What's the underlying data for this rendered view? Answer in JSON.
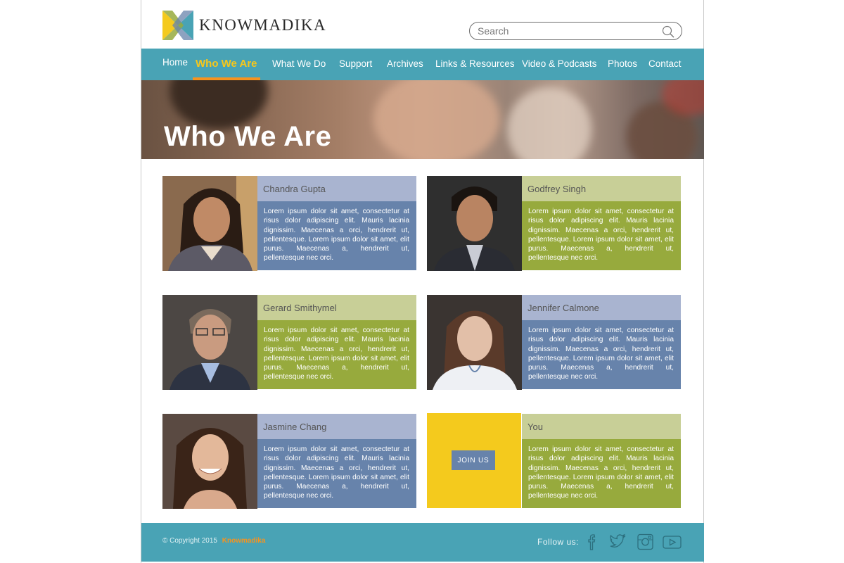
{
  "brand": {
    "name": "KNOWMADIKA"
  },
  "search": {
    "placeholder": "Search"
  },
  "nav": {
    "items": [
      {
        "label": "Home"
      },
      {
        "label": "Who We Are"
      },
      {
        "label": "What We Do"
      },
      {
        "label": "Support"
      },
      {
        "label": "Archives"
      },
      {
        "label": "Links & Resources"
      },
      {
        "label": "Video & Podcasts"
      },
      {
        "label": "Photos"
      },
      {
        "label": "Contact"
      }
    ],
    "active": "Who We Are"
  },
  "hero": {
    "title": "Who We Are"
  },
  "members": [
    {
      "name": "Chandra Gupta",
      "bio": "Lorem ipsum dolor sit amet, consectetur at risus dolor adipiscing elit. Mauris lacinia dignissim. Maecenas a orci, hendrerit ut, pellentesque. Lorem ipsum dolor sit amet, elit purus. Maecenas a, hendrerit ut, pellentesque nec orci."
    },
    {
      "name": "Godfrey Singh",
      "bio": "Lorem ipsum dolor sit amet, consectetur at risus dolor adipiscing elit. Mauris lacinia dignissim. Maecenas a orci, hendrerit ut, pellentesque. Lorem ipsum dolor sit amet, elit purus. Maecenas a, hendrerit ut, pellentesque nec orci."
    },
    {
      "name": "Gerard Smithymel",
      "bio": "Lorem ipsum dolor sit amet, consectetur at risus dolor adipiscing elit. Mauris lacinia dignissim. Maecenas a orci, hendrerit ut, pellentesque. Lorem ipsum dolor sit amet, elit purus. Maecenas a, hendrerit ut, pellentesque nec orci."
    },
    {
      "name": "Jennifer Calmone",
      "bio": "Lorem ipsum dolor sit amet, consectetur at risus dolor adipiscing elit. Mauris lacinia dignissim. Maecenas a orci, hendrerit ut, pellentesque. Lorem ipsum dolor sit amet, elit purus. Maecenas a, hendrerit ut, pellentesque nec orci."
    },
    {
      "name": "Jasmine Chang",
      "bio": "Lorem ipsum dolor sit amet, consectetur at risus dolor adipiscing elit. Mauris lacinia dignissim. Maecenas a orci, hendrerit ut, pellentesque. Lorem ipsum dolor sit amet, elit purus. Maecenas a, hendrerit ut, pellentesque nec orci."
    },
    {
      "name": "You",
      "bio": "Lorem ipsum dolor sit amet, consectetur at risus dolor adipiscing elit. Mauris lacinia dignissim. Maecenas a orci, hendrerit ut, pellentesque. Lorem ipsum dolor sit amet, elit purus. Maecenas a, hendrerit ut, pellentesque nec orci."
    }
  ],
  "join": {
    "label": "JOIN US"
  },
  "footer": {
    "copyright": "© Copyright 2015",
    "brand": "Knowmadika",
    "follow_label": "Follow us:",
    "social": [
      "facebook-icon",
      "twitter-icon",
      "instagram-icon",
      "youtube-icon"
    ]
  },
  "colors": {
    "nav_bg": "#49a3b5",
    "active_text": "#f6c71c",
    "active_underline": "#f7931e",
    "lavender": "#a9b4d0",
    "olive_light": "#c8cf97",
    "blue": "#6783ab",
    "olive": "#97aa3d",
    "join_yellow": "#f4ca1d"
  }
}
